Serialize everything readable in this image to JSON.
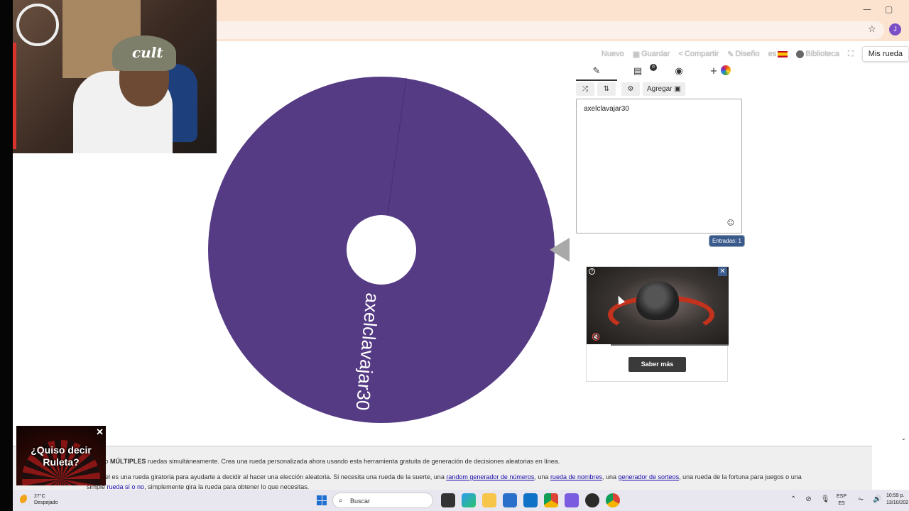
{
  "browser": {
    "window_controls": {
      "minimize": "—",
      "maximize": "▢"
    },
    "star": "☆",
    "profile_initial": "J"
  },
  "nav": {
    "nuevo": "Nuevo",
    "guardar": "Guardar",
    "compartir": "Compartir",
    "diseno": "Diseño",
    "language": "es",
    "biblioteca": "Biblioteca",
    "mis_ruedas": "Mis rueda"
  },
  "wheel": {
    "segment_label": "axelclavajar30",
    "color": "#553a84"
  },
  "editor": {
    "tabs": [
      "✎",
      "▤",
      "◉",
      "+"
    ],
    "toolbar": {
      "shuffle": "⤮",
      "sort": "⇅",
      "settings": "⚙",
      "agregar": "Agregar ▣"
    },
    "entries_text": "axelclavajar30",
    "emoji_icon": "☺",
    "entry_count": "Entradas: 1"
  },
  "ad": {
    "info": "?",
    "close": "✕",
    "mute": "🔇",
    "cta": "Saber más",
    "progress": 0.17
  },
  "description": {
    "line1_pre": "rueda o ",
    "line1_bold": "MÚLTIPLES",
    "line1_post": " ruedas simultáneamente. Crea una rueda personalizada ahora usando esta herramienta gratuita de generación de decisiones aleatorias en línea.",
    "line2_pre": "e Wheel es una rueda giratoria para ayudarte a decidir al hacer una elección aleatoria. Si necesita una rueda de la suerte, una ",
    "link1": "random generador de números",
    "line2_mid1": ", una ",
    "link2": "rueda de nombres",
    "line2_mid2": ", una ",
    "link3": "generador de sorteos",
    "line2_post": ", una rueda de la fortuna para juegos o una",
    "line3_pre": "simple ",
    "link4": "rueda sí o no",
    "line3_post": ", simplemente gira la rueda para obtener lo que necesitas."
  },
  "webcam": {
    "cap_text": "cult"
  },
  "ruleta_ad": {
    "text_line1": "¿Quiso decir",
    "text_line2": "Ruleta?",
    "close": "✕"
  },
  "taskbar": {
    "temperature": "27°C",
    "weather": "Despejado",
    "search_placeholder": "Buscar",
    "search_icon": "⌕",
    "lang1": "ESP",
    "lang2": "ES",
    "time": "10:59 p.",
    "date": "13/10/202",
    "tray": [
      "⌃",
      "⊘",
      "🎙",
      "⏦",
      "🔊"
    ]
  },
  "colors": {
    "wheel": "#553a84",
    "badge": "#3a5a8c",
    "ad_cta": "#3a3a3a"
  }
}
